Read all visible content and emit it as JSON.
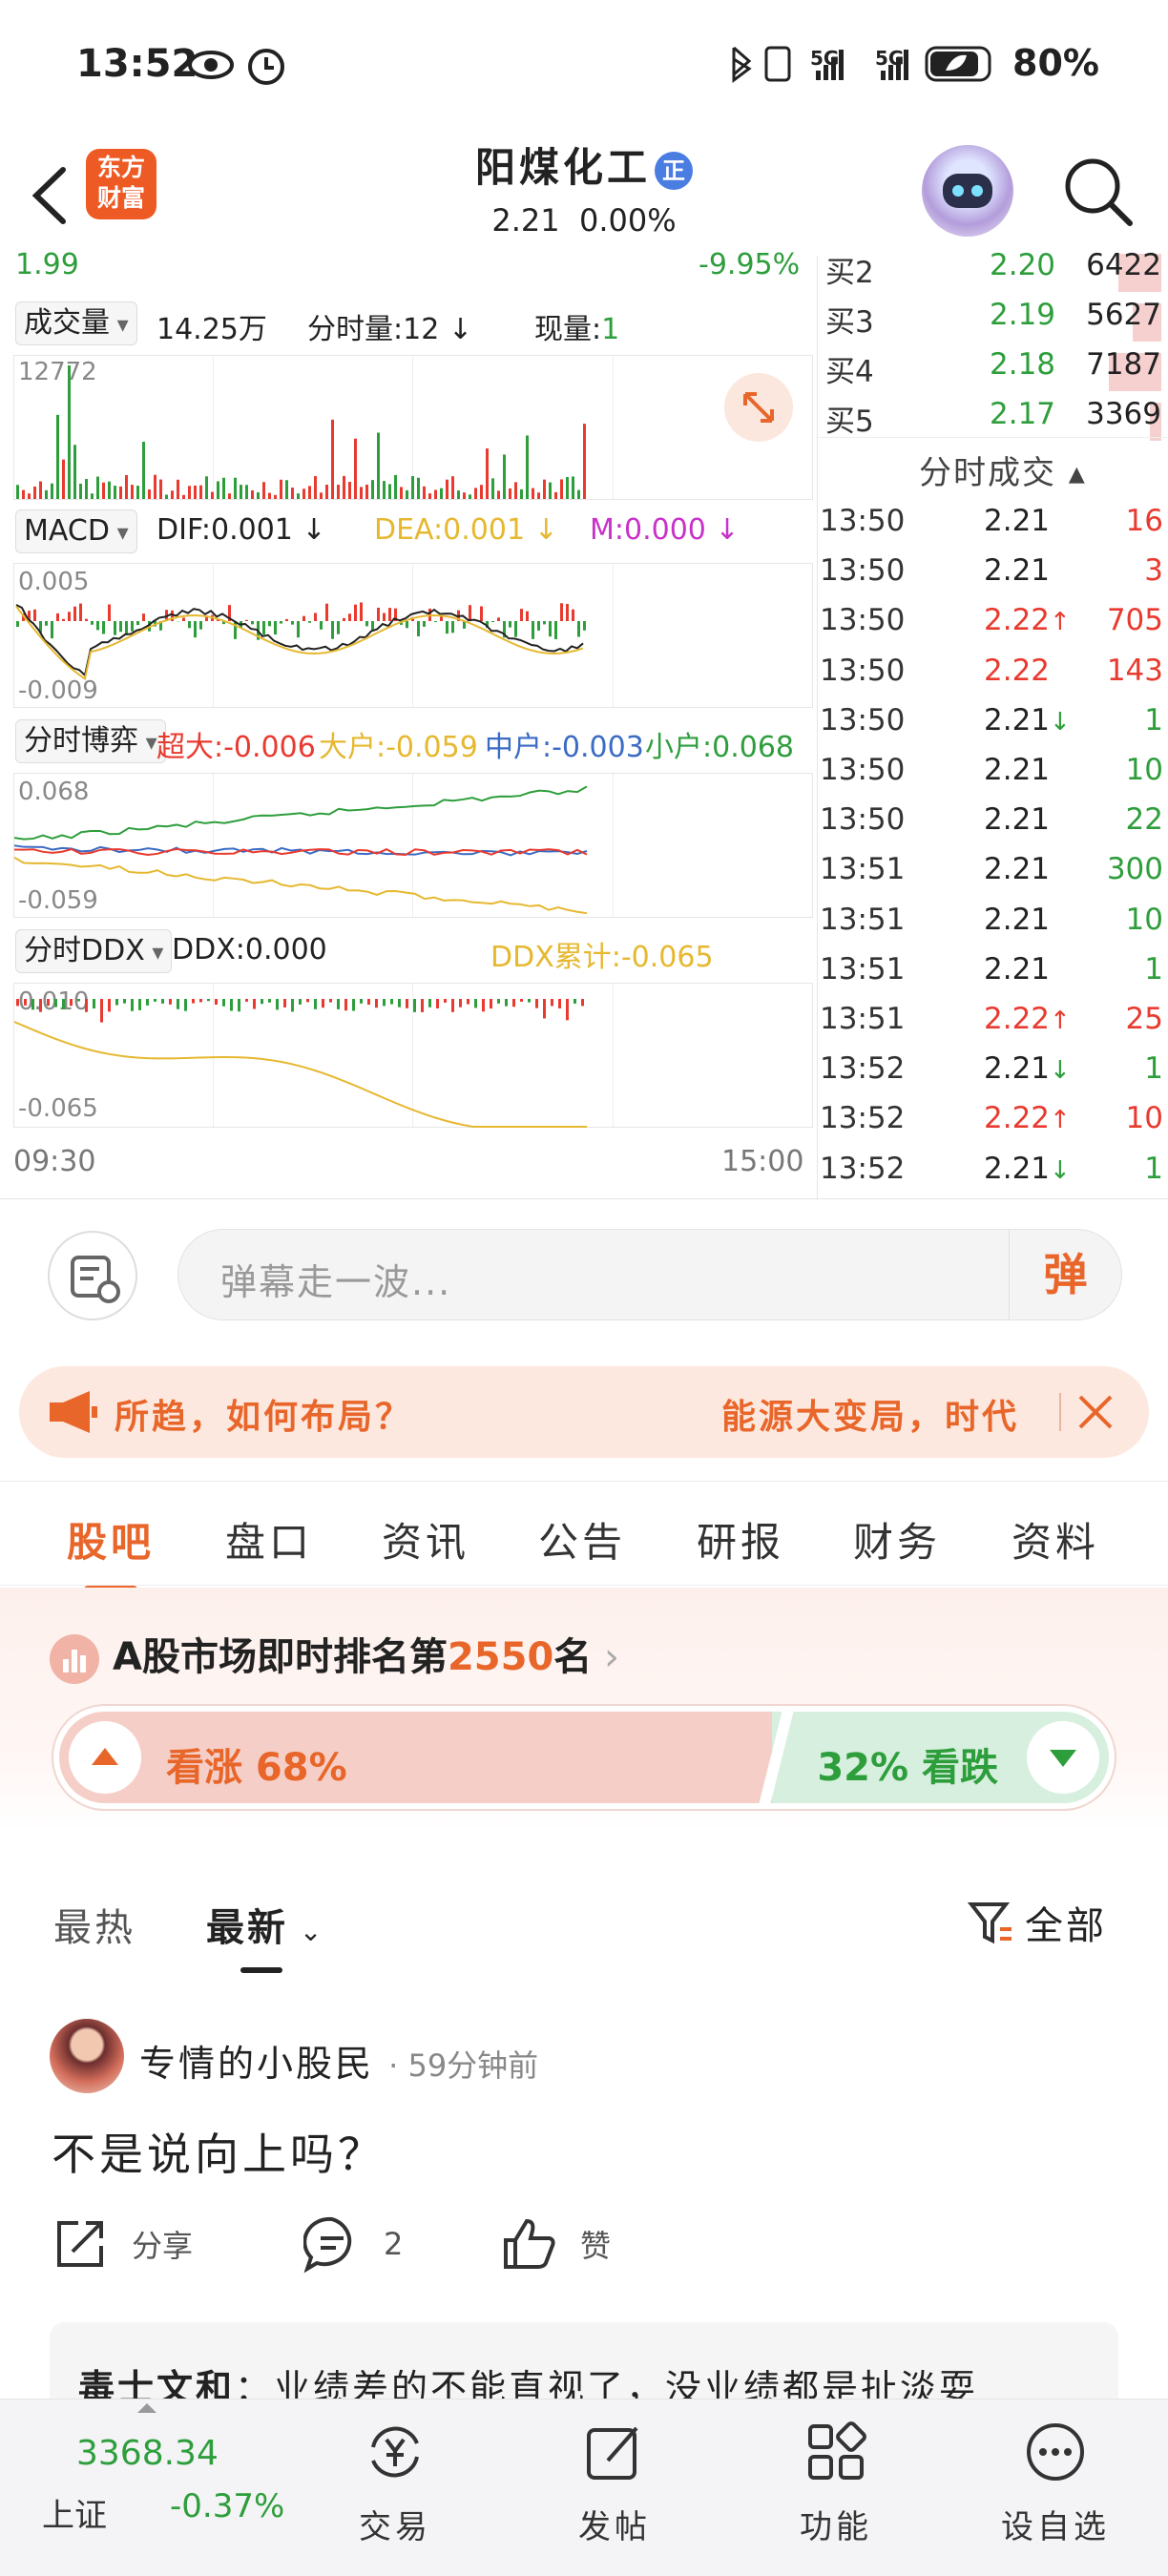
{
  "status": {
    "time": "13:52",
    "battery": "80%"
  },
  "header": {
    "brand_line1": "东方",
    "brand_line2": "财富",
    "title": "阳煤化工",
    "badge": "正",
    "price": "2.21",
    "change": "0.00%"
  },
  "chart": {
    "low_price": "1.99",
    "low_pct": "-9.95%",
    "volume": {
      "selector": "成交量",
      "value": "14.25万",
      "tick_label": "分时量:",
      "tick_value": "12",
      "current_label": "现量:",
      "current_value": "1",
      "max": "12772"
    },
    "macd": {
      "selector": "MACD",
      "dif": "DIF:0.001",
      "dea": "DEA:0.001",
      "m": "M:0.000",
      "top": "0.005",
      "bottom": "-0.009"
    },
    "game": {
      "selector": "分时博弈",
      "super": "超大:-0.006",
      "large": "大户:-0.059",
      "mid": "中户:-0.003",
      "small": "小户:0.068",
      "top": "0.068",
      "bottom": "-0.059"
    },
    "ddx": {
      "selector": "分时DDX",
      "ddx": "DDX:0.000",
      "cum": "DDX累计:-0.065",
      "top": "0.010",
      "bottom": "-0.065"
    },
    "time_start": "09:30",
    "time_end": "15:00"
  },
  "colors": {
    "up": "#e83a2f",
    "down": "#2e9e3c",
    "accent": "#e8662a",
    "yellow": "#e6b830",
    "purple": "#c832c8",
    "blue": "#3b6bc4"
  },
  "orderbook": [
    {
      "label": "买2",
      "price": "2.20",
      "vol": "6422",
      "fill": 0.45
    },
    {
      "label": "买3",
      "price": "2.19",
      "vol": "5627",
      "fill": 0.3
    },
    {
      "label": "买4",
      "price": "2.18",
      "vol": "7187",
      "fill": 0.55
    },
    {
      "label": "买5",
      "price": "2.17",
      "vol": "3369",
      "fill": 0.12
    }
  ],
  "trades_title": "分时成交",
  "trades": [
    {
      "time": "13:50",
      "price": "2.21",
      "arrow": "",
      "vol": "16",
      "pc": "n",
      "vc": "up"
    },
    {
      "time": "13:50",
      "price": "2.21",
      "arrow": "",
      "vol": "3",
      "pc": "n",
      "vc": "up"
    },
    {
      "time": "13:50",
      "price": "2.22",
      "arrow": "↑",
      "vol": "705",
      "pc": "up",
      "vc": "up"
    },
    {
      "time": "13:50",
      "price": "2.22",
      "arrow": "",
      "vol": "143",
      "pc": "up",
      "vc": "up"
    },
    {
      "time": "13:50",
      "price": "2.21",
      "arrow": "↓",
      "vol": "1",
      "pc": "n",
      "vc": "down"
    },
    {
      "time": "13:50",
      "price": "2.21",
      "arrow": "",
      "vol": "10",
      "pc": "n",
      "vc": "down"
    },
    {
      "time": "13:50",
      "price": "2.21",
      "arrow": "",
      "vol": "22",
      "pc": "n",
      "vc": "down"
    },
    {
      "time": "13:51",
      "price": "2.21",
      "arrow": "",
      "vol": "300",
      "pc": "n",
      "vc": "down"
    },
    {
      "time": "13:51",
      "price": "2.21",
      "arrow": "",
      "vol": "10",
      "pc": "n",
      "vc": "down"
    },
    {
      "time": "13:51",
      "price": "2.21",
      "arrow": "",
      "vol": "1",
      "pc": "n",
      "vc": "down"
    },
    {
      "time": "13:51",
      "price": "2.22",
      "arrow": "↑",
      "vol": "25",
      "pc": "up",
      "vc": "up"
    },
    {
      "time": "13:52",
      "price": "2.21",
      "arrow": "↓",
      "vol": "1",
      "pc": "n",
      "vc": "down"
    },
    {
      "time": "13:52",
      "price": "2.22",
      "arrow": "↑",
      "vol": "10",
      "pc": "up",
      "vc": "up"
    },
    {
      "time": "13:52",
      "price": "2.21",
      "arrow": "↓",
      "vol": "1",
      "pc": "n",
      "vc": "down"
    }
  ],
  "danmu": {
    "placeholder": "弹幕走一波...",
    "button": "弹"
  },
  "ticker": {
    "left": "所趋，如何布局？",
    "right": "能源大变局，时代"
  },
  "tabs": [
    "股吧",
    "盘口",
    "资讯",
    "公告",
    "研报",
    "财务",
    "资料"
  ],
  "ranking": {
    "prefix": "A股市场即时排名第",
    "rank": "2550",
    "suffix": "名"
  },
  "sentiment": {
    "up_label": "看涨 68%",
    "down_label": "32% 看跌",
    "up_fraction": 0.68
  },
  "sort": {
    "hot": "最热",
    "latest": "最新",
    "filter": "全部"
  },
  "post": {
    "author": "专情的小股民",
    "time": "· 59分钟前",
    "body": "不是说向上吗？",
    "share": "分享",
    "comments": "2",
    "like": "赞",
    "reply_author": "毒士文和",
    "reply_text": "：业绩差的不能直视了，没业绩都是扯淡耍"
  },
  "bottom_nav": {
    "index_value": "3368.34",
    "index_name": "上证",
    "index_change": "-0.37%",
    "items": [
      "交易",
      "发帖",
      "功能",
      "设自选"
    ]
  }
}
